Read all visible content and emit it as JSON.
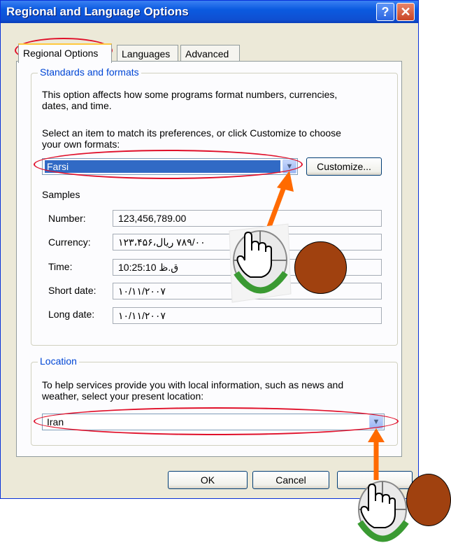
{
  "window": {
    "title": "Regional and Language Options",
    "help_glyph": "?",
    "close_glyph": "✕"
  },
  "tabs": [
    {
      "label": "Regional Options",
      "active": true
    },
    {
      "label": "Languages",
      "active": false
    },
    {
      "label": "Advanced",
      "active": false
    }
  ],
  "standards": {
    "legend": "Standards and formats",
    "desc_line1": "This option affects how some programs format numbers, currencies,",
    "desc_line2": "dates, and time.",
    "select_line1": "Select an item to match its preferences, or click Customize to choose",
    "select_line2": "your own formats:",
    "format_value": "Farsi",
    "customize_label": "Customize...",
    "samples_label": "Samples",
    "samples": [
      {
        "label": "Number:",
        "value": "123,456,789.00"
      },
      {
        "label": "Currency:",
        "value": "١٢٣،۴۵۶،٧٨٩/٠٠ ريال"
      },
      {
        "label": "Time:",
        "value": "10:25:10 ق.ظ"
      },
      {
        "label": "Short date:",
        "value": "١٠/١١/٢٠٠٧"
      },
      {
        "label": "Long date:",
        "value": "١٠/١١/٢٠٠٧"
      }
    ]
  },
  "location": {
    "legend": "Location",
    "desc_line1": "To help services provide you with local information, such as news and",
    "desc_line2": "weather, select your present location:",
    "value": "Iran"
  },
  "footer": {
    "ok_label": "OK",
    "cancel_label": "Cancel"
  },
  "colors": {
    "annotation_red": "#e0102a",
    "arrow_orange": "#ff6a00",
    "circle_brown": "#a0410f"
  },
  "icons": [
    "help-icon",
    "close-icon",
    "chevron-down-icon",
    "hand-cursor-icon"
  ]
}
